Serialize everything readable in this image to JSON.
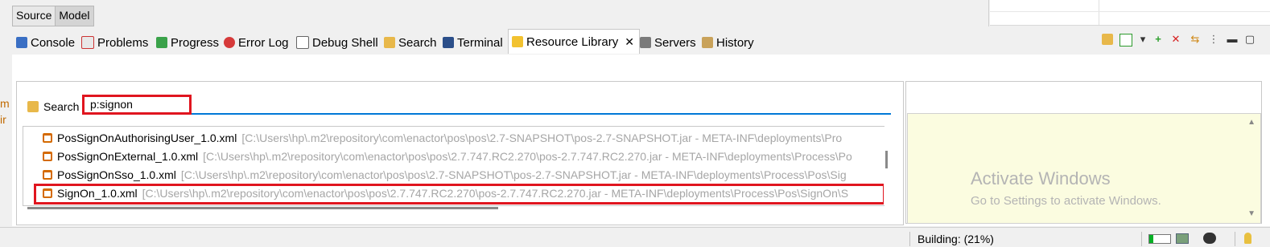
{
  "editor_tabs": [
    {
      "label": "Source",
      "active": false
    },
    {
      "label": "Model",
      "active": true
    }
  ],
  "view_tabs": [
    {
      "label": "Console",
      "icon": "console-icon"
    },
    {
      "label": "Problems",
      "icon": "problems-icon"
    },
    {
      "label": "Progress",
      "icon": "progress-icon"
    },
    {
      "label": "Error Log",
      "icon": "error-log-icon"
    },
    {
      "label": "Debug Shell",
      "icon": "debug-shell-icon"
    },
    {
      "label": "Search",
      "icon": "search-icon"
    },
    {
      "label": "Terminal",
      "icon": "terminal-icon"
    },
    {
      "label": "Resource Library",
      "icon": "resource-library-icon",
      "active": true,
      "close": "✕"
    },
    {
      "label": "Servers",
      "icon": "servers-icon"
    },
    {
      "label": "History",
      "icon": "history-icon"
    }
  ],
  "search": {
    "label": "Search",
    "value": "p:signon"
  },
  "results": [
    {
      "name": "PosSignOnAuthorisingUser_1.0.xml",
      "path": "[C:\\Users\\hp\\.m2\\repository\\com\\enactor\\pos\\pos\\2.7-SNAPSHOT\\pos-2.7-SNAPSHOT.jar - META-INF\\deployments\\Pro"
    },
    {
      "name": "PosSignOnExternal_1.0.xml",
      "path": "[C:\\Users\\hp\\.m2\\repository\\com\\enactor\\pos\\pos\\2.7.747.RC2.270\\pos-2.7.747.RC2.270.jar - META-INF\\deployments\\Process\\Po"
    },
    {
      "name": "PosSignOnSso_1.0.xml",
      "path": "[C:\\Users\\hp\\.m2\\repository\\com\\enactor\\pos\\pos\\2.7-SNAPSHOT\\pos-2.7-SNAPSHOT.jar - META-INF\\deployments\\Process\\Pos\\Sig"
    },
    {
      "name": "SignOn_1.0.xml",
      "path": "[C:\\Users\\hp\\.m2\\repository\\com\\enactor\\pos\\pos\\2.7.747.RC2.270\\pos-2.7.747.RC2.270.jar - META-INF\\deployments\\Process\\Pos\\SignOn\\S",
      "highlighted": true
    }
  ],
  "watermark": {
    "line1": "Activate Windows",
    "line2": "Go to Settings to activate Windows."
  },
  "status": {
    "building": "Building: (21%)",
    "progress": 0.21
  },
  "left_cutoff": [
    "m",
    "ir"
  ],
  "colors": {
    "highlight_red": "#e0151f",
    "focus_blue": "#0078d7",
    "xml_icon": "#d46a00"
  }
}
